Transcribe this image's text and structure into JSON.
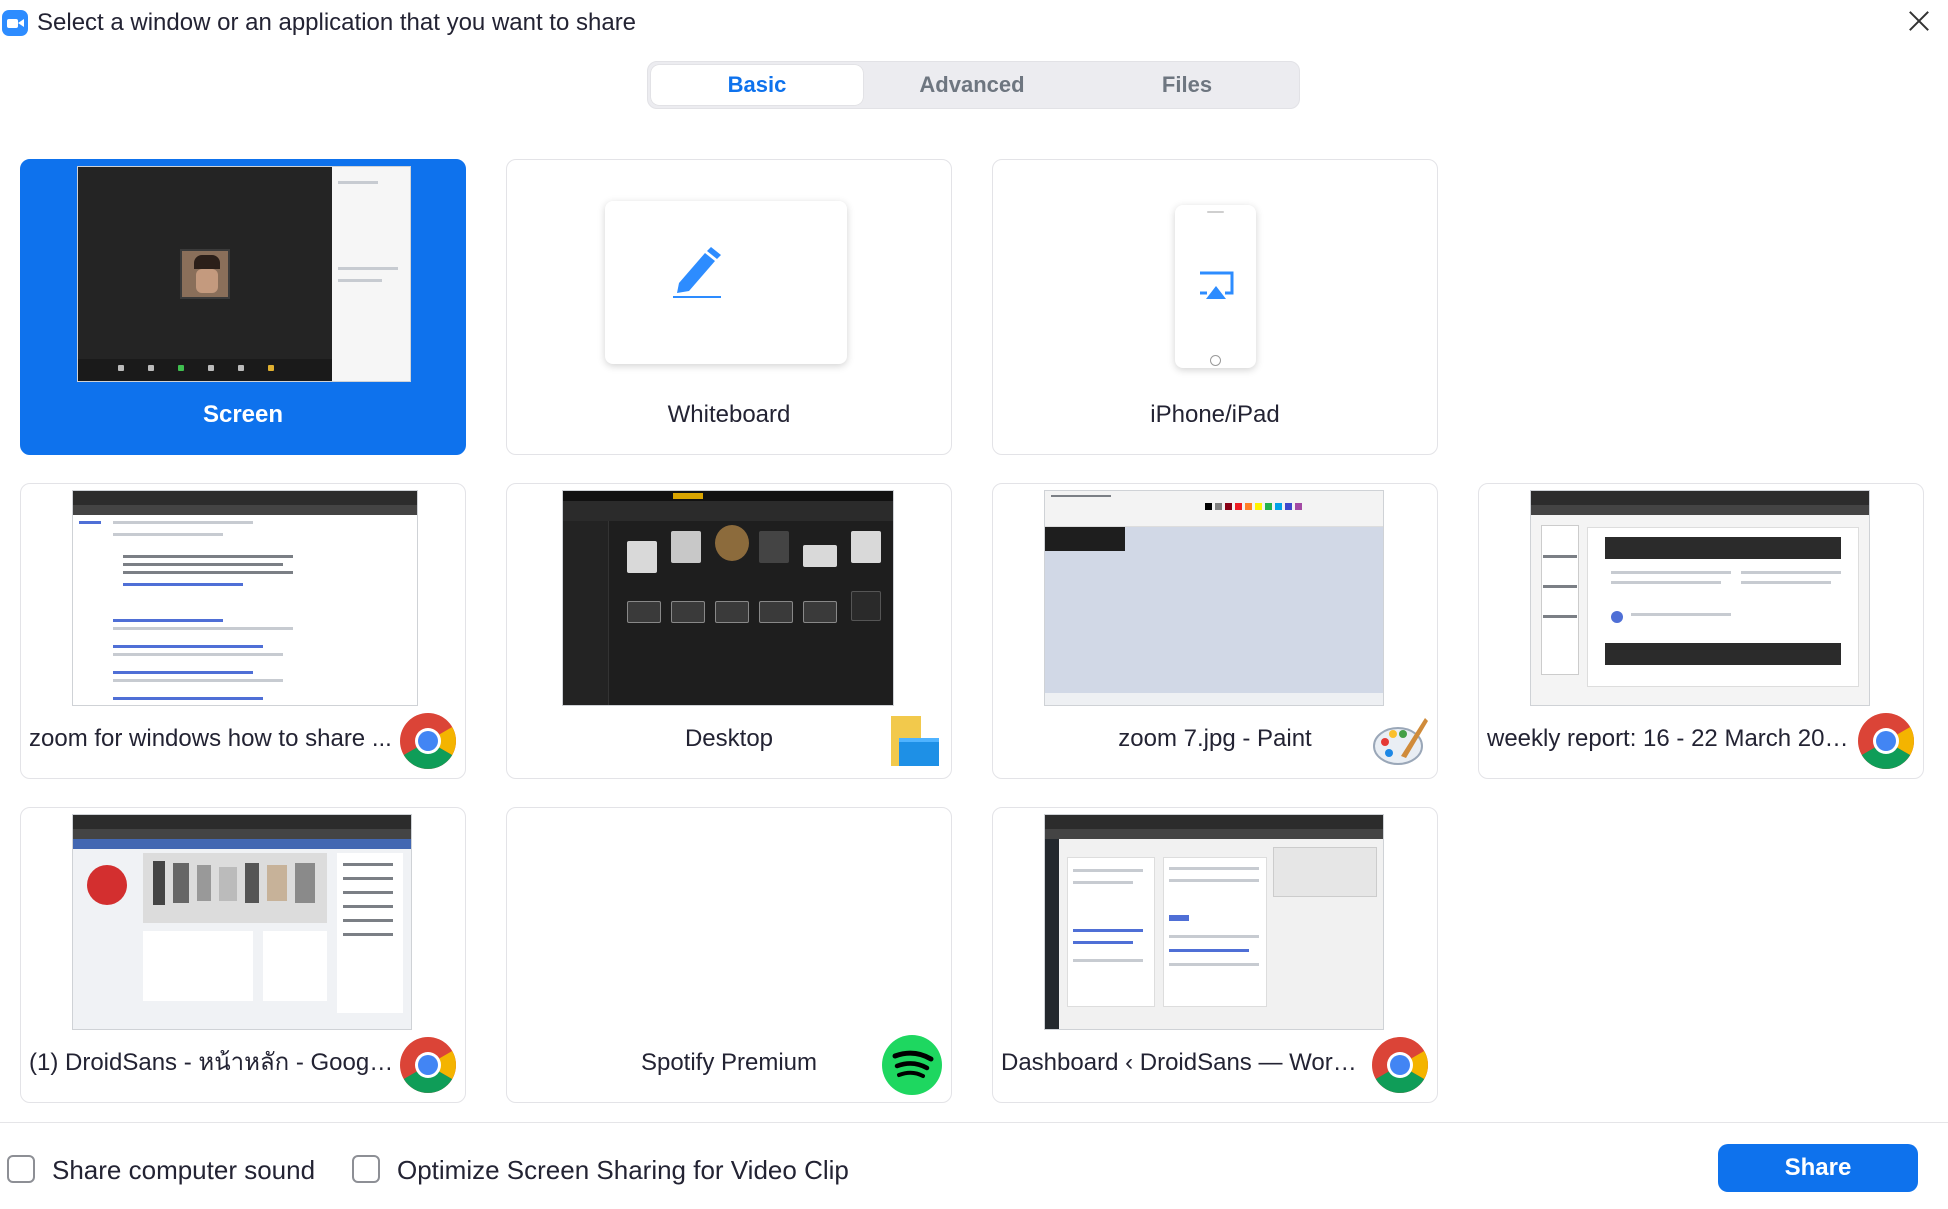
{
  "window": {
    "title": "Select a window or an application that you want to share"
  },
  "tabs": [
    {
      "label": "Basic",
      "active": true
    },
    {
      "label": "Advanced",
      "active": false
    },
    {
      "label": "Files",
      "active": false
    }
  ],
  "cards": [
    {
      "label": "Screen",
      "selected": true
    },
    {
      "label": "Whiteboard",
      "selected": false
    },
    {
      "label": "iPhone/iPad",
      "selected": false
    },
    {
      "label": "zoom for windows how to share ...",
      "app_icon": "chrome-icon"
    },
    {
      "label": "Desktop",
      "app_icon": "file-explorer-icon"
    },
    {
      "label": "zoom 7.jpg - Paint",
      "app_icon": "paint-icon"
    },
    {
      "label": "weekly report: 16 - 22 March 202...",
      "app_icon": "chrome-icon"
    },
    {
      "label": "(1) DroidSans - หน้าหลัก - Google ...",
      "app_icon": "chrome-icon"
    },
    {
      "label": "Spotify Premium",
      "app_icon": "spotify-icon"
    },
    {
      "label": "Dashboard ‹ DroidSans — WordP...",
      "app_icon": "chrome-icon"
    }
  ],
  "options": {
    "share_sound": {
      "label": "Share computer sound",
      "checked": false
    },
    "optimize_video": {
      "label": "Optimize Screen Sharing for Video Clip",
      "checked": false
    }
  },
  "actions": {
    "share_label": "Share"
  },
  "colors": {
    "accent": "#0e72ed",
    "zoom_blue": "#2d8cff",
    "spotify_green": "#1ed760"
  }
}
